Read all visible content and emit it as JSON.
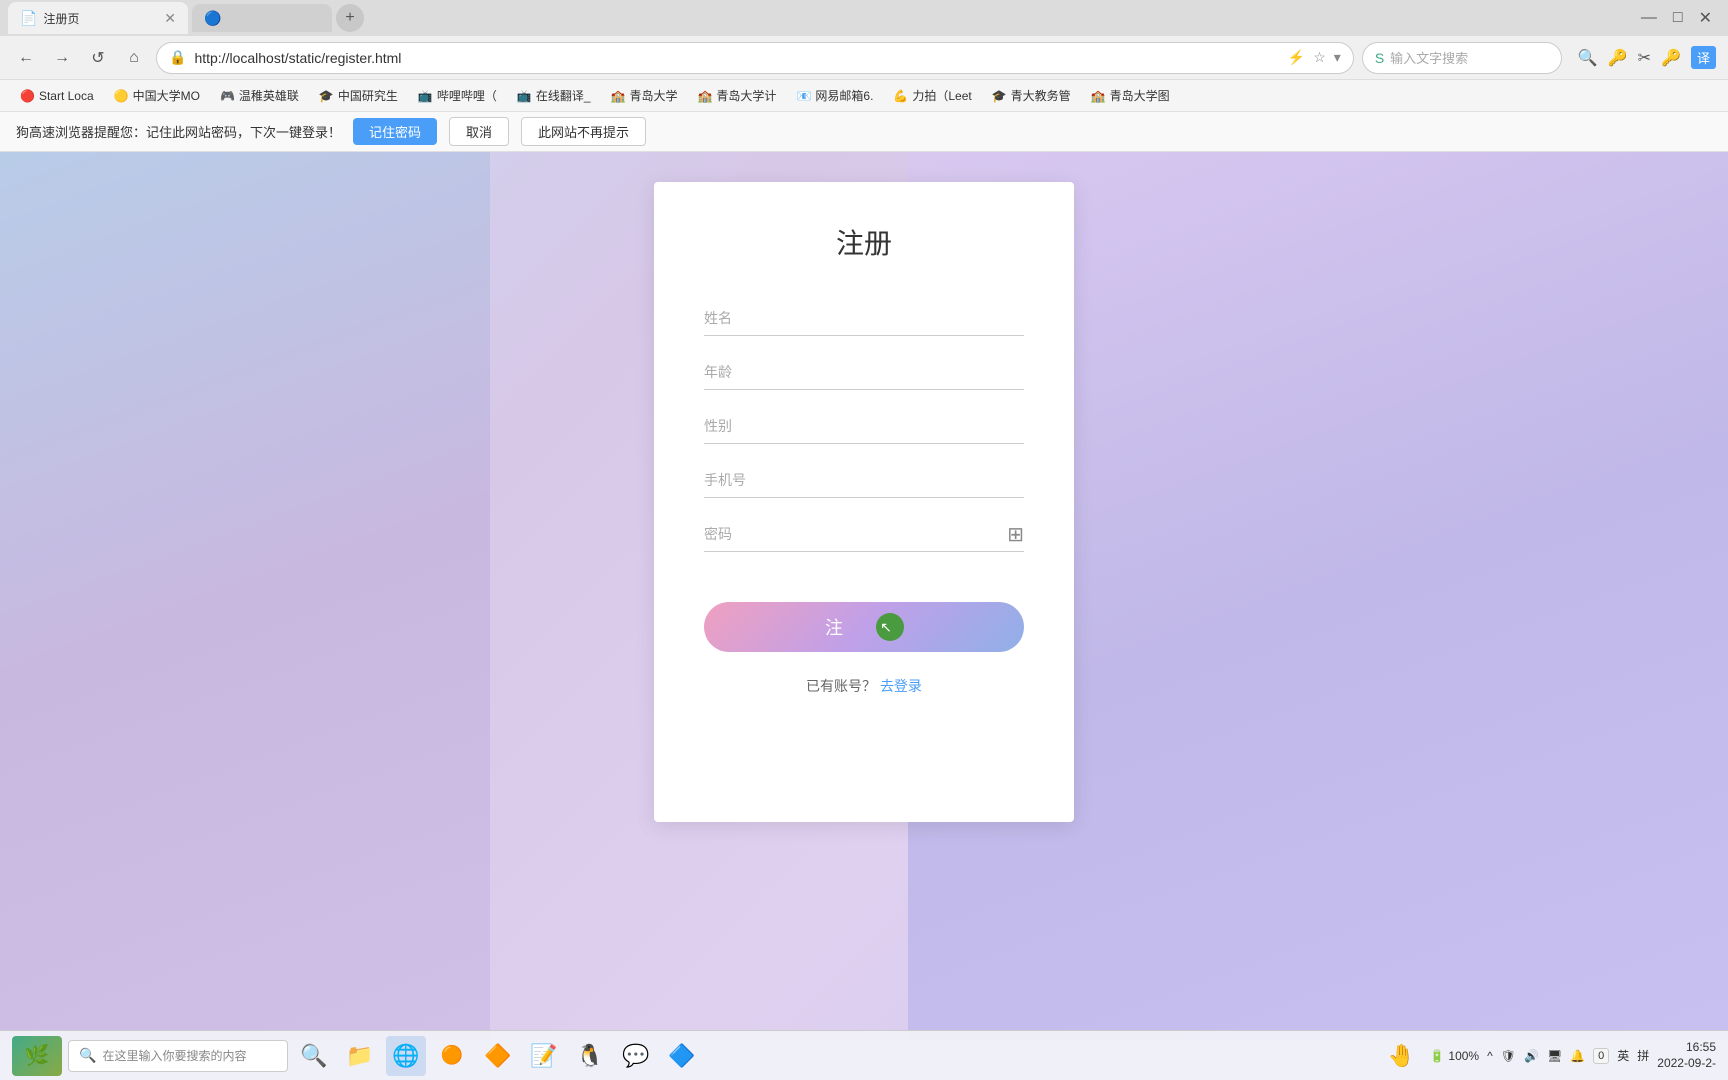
{
  "browser": {
    "tab_active": {
      "icon": "📄",
      "label": "注册页",
      "url_display": "http://localhost/static/register.html"
    },
    "tab_inactive": {
      "icon": "🔵",
      "label": ""
    },
    "nav": {
      "back": "←",
      "forward": "→",
      "refresh": "↺",
      "home": "⌂"
    },
    "address": "http://localhost/static/register.html",
    "search_placeholder": "输入文字搜索",
    "toolbar_controls": [
      "−",
      "□",
      "×"
    ]
  },
  "bookmarks": [
    {
      "icon": "🔴",
      "label": "Start Loca"
    },
    {
      "icon": "🟡",
      "label": "中国大学MO"
    },
    {
      "icon": "🎮",
      "label": "温稚英雄联"
    },
    {
      "icon": "🎓",
      "label": "中国研究生"
    },
    {
      "icon": "📺",
      "label": "哔哩哔哩（"
    },
    {
      "icon": "📺",
      "label": "在线翻译_"
    },
    {
      "icon": "🏫",
      "label": "青岛大学"
    },
    {
      "icon": "🏫",
      "label": "青岛大学计"
    },
    {
      "icon": "📧",
      "label": "网易邮箱6."
    },
    {
      "icon": "💪",
      "label": "力拍（Leet"
    },
    {
      "icon": "🎓",
      "label": "青大教务管"
    },
    {
      "icon": "🏫",
      "label": "青岛大学图"
    },
    {
      "icon": "🔵",
      "label": ""
    }
  ],
  "notification": {
    "text": "狗高速浏览器提醒您：记住此网站密码，下次一键登录！",
    "btn_remember": "记住密码",
    "btn_cancel": "取消",
    "btn_no_more": "此网站不再提示"
  },
  "form": {
    "title": "注册",
    "fields": [
      {
        "placeholder": "姓名",
        "type": "text"
      },
      {
        "placeholder": "年龄",
        "type": "text"
      },
      {
        "placeholder": "性别",
        "type": "text"
      },
      {
        "placeholder": "手机号",
        "type": "text"
      },
      {
        "placeholder": "密码",
        "type": "password"
      }
    ],
    "submit_label": "注　册",
    "login_text": "已有账号？",
    "login_link": "去登录"
  },
  "taskbar": {
    "search_placeholder": "在这里输入你要搜索的内容",
    "time": "16:55",
    "date": "2022-09-2-",
    "battery": "100%",
    "lang": "英",
    "input_method": "拼",
    "shield_label": "0"
  }
}
